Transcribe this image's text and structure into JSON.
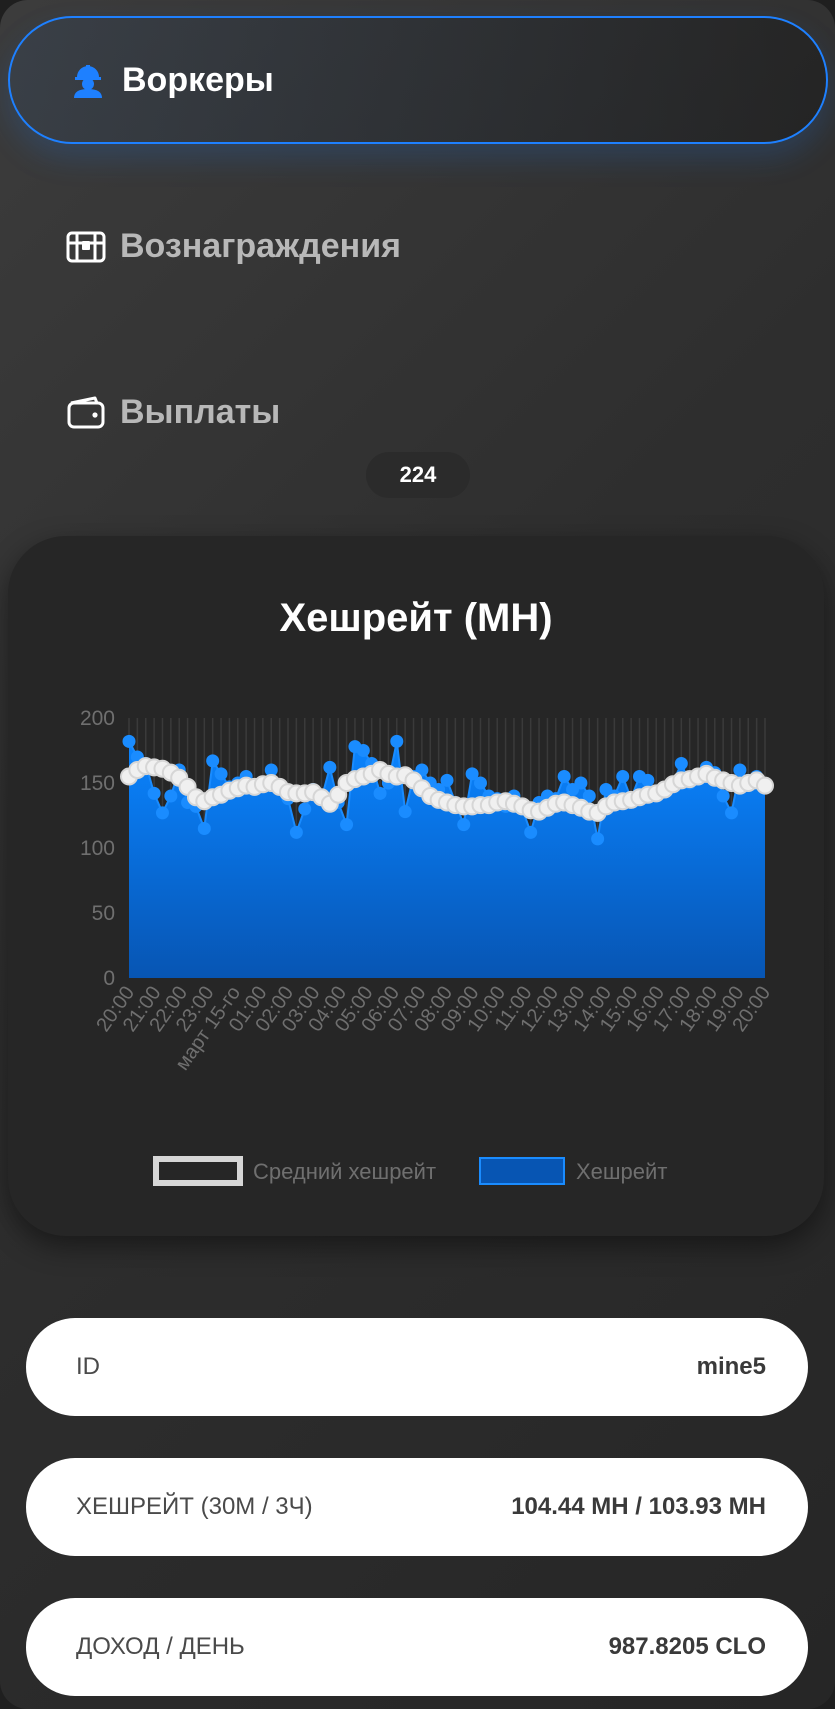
{
  "nav": {
    "workers": "Воркеры",
    "rewards": "Вознаграждения",
    "payouts": "Выплаты",
    "count_badge": "224"
  },
  "colors": {
    "accent": "#1e80ff",
    "area_top": "#0a84ff",
    "area_bottom": "#0755b3",
    "average_line": "#ffffff",
    "card_bg": "#262626"
  },
  "icons": {
    "workers": "worker-helmet-icon",
    "rewards": "treasure-chest-icon",
    "payouts": "wallet-icon"
  },
  "chart_data": {
    "type": "area",
    "title": "Хешрейт (MH)",
    "xlabel": "",
    "ylabel": "",
    "ylim": [
      0,
      200
    ],
    "yticks": [
      0,
      50,
      100,
      150,
      200
    ],
    "xticks": [
      "20:00",
      "21:00",
      "22:00",
      "23:00",
      "март 15-го",
      "01:00",
      "02:00",
      "03:00",
      "04:00",
      "05:00",
      "06:00",
      "07:00",
      "08:00",
      "09:00",
      "10:00",
      "11:00",
      "12:00",
      "13:00",
      "14:00",
      "15:00",
      "16:00",
      "17:00",
      "18:00",
      "19:00",
      "20:00"
    ],
    "legend_position": "bottom",
    "grid": false,
    "series": [
      {
        "name": "Средний хешрейт",
        "values": [
          155,
          160,
          163,
          162,
          161,
          158,
          154,
          147,
          139,
          136,
          139,
          141,
          144,
          146,
          148,
          147,
          149,
          150,
          147,
          143,
          142,
          142,
          143,
          139,
          134,
          141,
          150,
          153,
          155,
          157,
          160,
          157,
          155,
          156,
          152,
          146,
          140,
          137,
          135,
          133,
          132,
          132,
          133,
          133,
          135,
          136,
          134,
          132,
          129,
          128,
          131,
          134,
          135,
          133,
          131,
          128,
          127,
          132,
          135,
          136,
          137,
          139,
          141,
          142,
          145,
          149,
          152,
          153,
          155,
          157,
          154,
          152,
          150,
          148,
          150,
          152,
          148
        ]
      },
      {
        "name": "Хешрейт",
        "values": [
          182,
          170,
          165,
          142,
          127,
          140,
          160,
          135,
          132,
          115,
          167,
          157,
          147,
          150,
          155,
          145,
          150,
          160,
          148,
          138,
          112,
          130,
          145,
          138,
          162,
          135,
          118,
          178,
          175,
          165,
          142,
          150,
          182,
          128,
          155,
          160,
          150,
          145,
          152,
          135,
          118,
          157,
          150,
          140,
          138,
          132,
          140,
          130,
          112,
          135,
          140,
          138,
          155,
          145,
          150,
          140,
          107,
          145,
          140,
          155,
          138,
          155,
          152,
          140,
          145,
          150,
          165,
          150,
          155,
          162,
          158,
          140,
          127,
          160,
          152,
          155,
          148
        ]
      }
    ]
  },
  "info": {
    "id_label": "ID",
    "id_value": "mine5",
    "hashrate_label": "ХЕШРЕЙТ (30М / 3Ч)",
    "hashrate_value": "104.44 MH / 103.93 MH",
    "income_label": "ДОХОД / ДЕНЬ",
    "income_value": "987.8205 CLO"
  }
}
